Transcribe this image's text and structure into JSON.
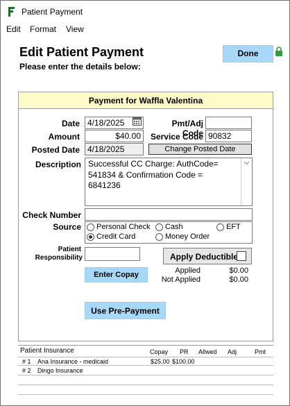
{
  "window": {
    "title": "Patient Payment"
  },
  "menu": {
    "items": [
      "Edit",
      "Format",
      "View"
    ]
  },
  "header": {
    "title": "Edit Patient Payment",
    "subtitle": "Please enter the details below:",
    "done_label": "Done"
  },
  "payment": {
    "header": "Payment for Waffla Valentina",
    "date_label": "Date",
    "date_value": "4/18/2025",
    "amount_label": "Amount",
    "amount_value": "$40.00",
    "posted_date_label": "Posted Date",
    "posted_date_value": "4/18/2025",
    "pmt_adj_code_label": "Pmt/Adj Code",
    "pmt_adj_code_value": "",
    "service_code_label": "Service Code",
    "service_code_value": "90832",
    "change_posted_date_label": "Change Posted Date",
    "description_label": "Description",
    "description_value": "Successful CC Charge: AuthCode= 541834 & Confirmation Code = 6841236",
    "check_number_label": "Check Number",
    "check_number_value": "",
    "source_label": "Source",
    "source_options": [
      "Personal Check",
      "Cash",
      "EFT",
      "Credit Card",
      "Money Order"
    ],
    "source_selected": "Credit Card",
    "patient_resp_label_1": "Patient",
    "patient_resp_label_2": "Responsibility",
    "patient_resp_value": "",
    "apply_deductible_label": "Apply Deductible",
    "apply_deductible_checked": false,
    "enter_copay_label": "Enter Copay",
    "applied_label": "Applied",
    "applied_value": "$0.00",
    "not_applied_label": "Not Applied",
    "not_applied_value": "$0.00",
    "use_prepayment_label": "Use Pre-Payment"
  },
  "insurance": {
    "title": "Patient Insurance",
    "columns": [
      "Copay",
      "PR",
      "Allwed",
      "Adj",
      "Pmt"
    ],
    "rows": [
      {
        "num": "# 1",
        "name": "Ana Insurance - medicaid",
        "copay": "$25.00",
        "pr": "$100.00"
      },
      {
        "num": "# 2",
        "name": "Dingo Insurance",
        "copay": "",
        "pr": ""
      }
    ]
  },
  "colors": {
    "accent_button": "#a8d8f8",
    "panel_header": "#fffbc8",
    "lock_icon": "#2e9e3e"
  }
}
